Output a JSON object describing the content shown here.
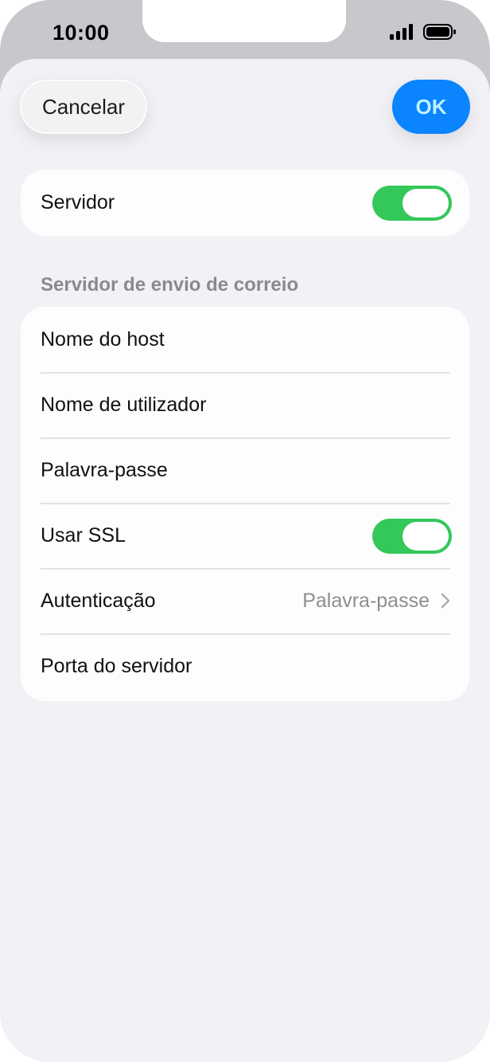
{
  "status_bar": {
    "time": "10:00"
  },
  "header": {
    "cancel_label": "Cancelar",
    "ok_label": "OK"
  },
  "server_card": {
    "label": "Servidor",
    "toggle_on": true
  },
  "outgoing": {
    "section_title": "Servidor de envio de correio",
    "rows": [
      {
        "label": "Nome do host"
      },
      {
        "label": "Nome de utilizador"
      },
      {
        "label": "Palavra-passe"
      },
      {
        "label": "Usar SSL",
        "toggle_on": true
      },
      {
        "label": "Autenticação",
        "value": "Palavra-passe"
      },
      {
        "label": "Porta do servidor"
      }
    ]
  },
  "colors": {
    "accent": "#0a84ff",
    "toggle_on": "#34c759",
    "background": "#f1f1f6"
  },
  "icons": [
    "signal-icon",
    "wifi-icon",
    "battery-icon",
    "chevron-right-icon"
  ]
}
